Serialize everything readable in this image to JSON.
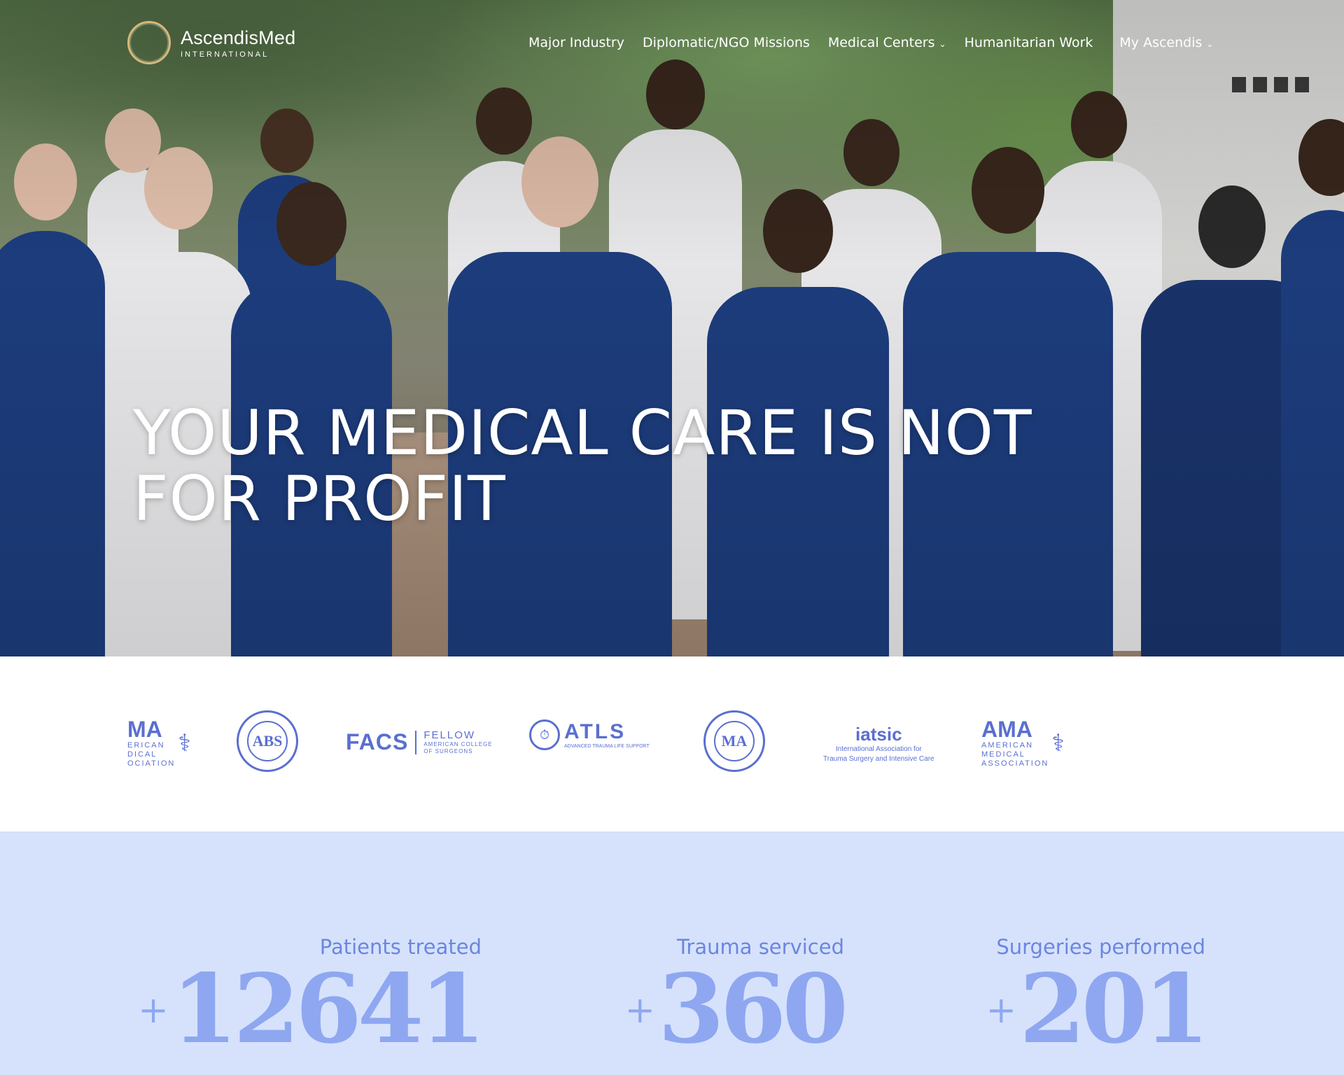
{
  "brand": {
    "name": "AscendisMed",
    "subtitle": "INTERNATIONAL",
    "logo_color": "#d9b977"
  },
  "nav": {
    "items": [
      {
        "label": "Major Industry",
        "has_dropdown": false
      },
      {
        "label": "Diplomatic/NGO Missions",
        "has_dropdown": false
      },
      {
        "label": "Medical Centers",
        "has_dropdown": true
      },
      {
        "label": "Humanitarian Work",
        "has_dropdown": false
      },
      {
        "label": "My Ascendis",
        "has_dropdown": true
      }
    ],
    "dropdown_icon": "chevron-down-icon"
  },
  "hero": {
    "title": "YOUR MEDICAL CARE IS NOT FOR PROFIT",
    "image": "group of medical staff in blue scrubs making heart hand gestures"
  },
  "partners": {
    "ama_partial": {
      "big": "MA",
      "small": [
        "ERICAN",
        "DICAL",
        "OCIATION"
      ]
    },
    "abs": {
      "mark": "ABS"
    },
    "facs": {
      "big": "FACS",
      "line1": "FELLOW",
      "line2": "AMERICAN COLLEGE",
      "line3": "OF SURGEONS"
    },
    "atls": {
      "big": "ATLS",
      "small": "ADVANCED TRAUMA LIFE SUPPORT"
    },
    "seal": {
      "mark": "MA"
    },
    "iatsic": {
      "big": "iatsic",
      "line1": "International Association for",
      "line2": "Trauma Surgery and Intensive Care"
    },
    "ama": {
      "big": "AMA",
      "small": [
        "AMERICAN",
        "MEDICAL",
        "ASSOCIATION"
      ]
    },
    "color": "#5a6fd0"
  },
  "stats": {
    "background": "#d6e2fc",
    "items": [
      {
        "label": "Patients treated",
        "prefix": "+",
        "value": "12641"
      },
      {
        "label": "Trauma serviced",
        "prefix": "+",
        "value": "360"
      },
      {
        "label": "Surgeries performed",
        "prefix": "+",
        "value": "201"
      }
    ]
  }
}
